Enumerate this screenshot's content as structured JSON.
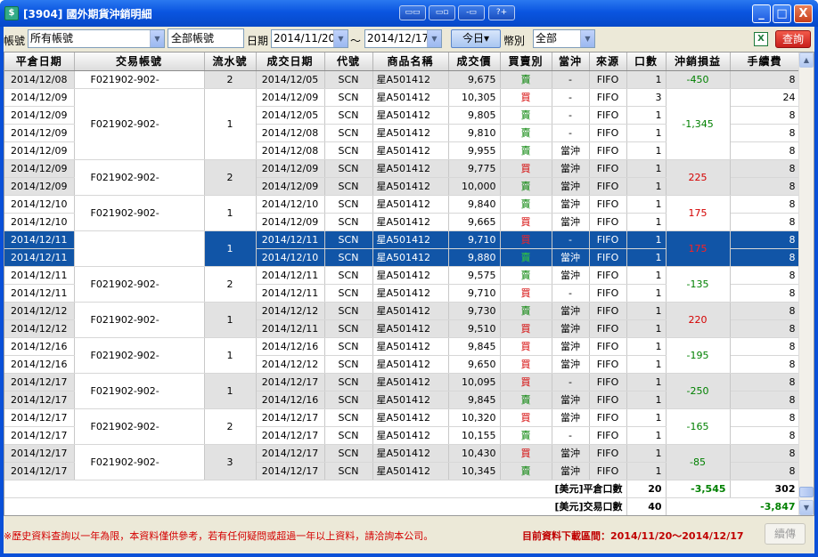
{
  "window": {
    "title": "[3904] 國外期貨沖銷明細",
    "app_icon": "app-icon",
    "toolbar_buttons": [
      "window-layout-icon-1",
      "window-layout-icon-2",
      "window-layout-icon-3",
      "window-layout-icon-4"
    ],
    "minimize": "_",
    "maximize": "□",
    "close": "X"
  },
  "filters": {
    "account_label": "帳號",
    "account_value": "所有帳號",
    "account_text": "全部帳號",
    "date_label": "日期",
    "date_from": "2014/11/20",
    "tilde": "～",
    "date_to": "2014/12/17",
    "today_button": "今日▾",
    "currency_label": "幣別",
    "currency_value": "全部",
    "query_button": "查詢"
  },
  "columns": [
    "平倉日期",
    "交易帳號",
    "流水號",
    "成交日期",
    "代號",
    "商品名稱",
    "成交價",
    "買賣別",
    "當沖",
    "來源",
    "口數",
    "沖銷損益",
    "手續費"
  ],
  "rows": [
    {
      "close_date": "2014/12/08",
      "trade_date": "2014/12/05",
      "code": "SCN",
      "product": "星A501412",
      "price": "9,675",
      "side": "賣",
      "daytrade": "-",
      "source": "FIFO",
      "lots": "1",
      "fee": "8"
    },
    {
      "close_date": "2014/12/09",
      "trade_date": "2014/12/09",
      "code": "SCN",
      "product": "星A501412",
      "price": "10,305",
      "side": "買",
      "daytrade": "-",
      "source": "FIFO",
      "lots": "3",
      "fee": "24"
    },
    {
      "close_date": "2014/12/09",
      "trade_date": "2014/12/05",
      "code": "SCN",
      "product": "星A501412",
      "price": "9,805",
      "side": "賣",
      "daytrade": "-",
      "source": "FIFO",
      "lots": "1",
      "fee": "8"
    },
    {
      "close_date": "2014/12/09",
      "trade_date": "2014/12/08",
      "code": "SCN",
      "product": "星A501412",
      "price": "9,810",
      "side": "賣",
      "daytrade": "-",
      "source": "FIFO",
      "lots": "1",
      "fee": "8"
    },
    {
      "close_date": "2014/12/09",
      "trade_date": "2014/12/08",
      "code": "SCN",
      "product": "星A501412",
      "price": "9,955",
      "side": "賣",
      "daytrade": "當沖",
      "source": "FIFO",
      "lots": "1",
      "fee": "8"
    },
    {
      "close_date": "2014/12/09",
      "trade_date": "2014/12/09",
      "code": "SCN",
      "product": "星A501412",
      "price": "9,775",
      "side": "買",
      "daytrade": "當沖",
      "source": "FIFO",
      "lots": "1",
      "fee": "8"
    },
    {
      "close_date": "2014/12/09",
      "trade_date": "2014/12/09",
      "code": "SCN",
      "product": "星A501412",
      "price": "10,000",
      "side": "賣",
      "daytrade": "當沖",
      "source": "FIFO",
      "lots": "1",
      "fee": "8"
    },
    {
      "close_date": "2014/12/10",
      "trade_date": "2014/12/10",
      "code": "SCN",
      "product": "星A501412",
      "price": "9,840",
      "side": "賣",
      "daytrade": "當沖",
      "source": "FIFO",
      "lots": "1",
      "fee": "8"
    },
    {
      "close_date": "2014/12/10",
      "trade_date": "2014/12/09",
      "code": "SCN",
      "product": "星A501412",
      "price": "9,665",
      "side": "買",
      "daytrade": "當沖",
      "source": "FIFO",
      "lots": "1",
      "fee": "8"
    },
    {
      "close_date": "2014/12/11",
      "trade_date": "2014/12/11",
      "code": "SCN",
      "product": "星A501412",
      "price": "9,710",
      "side": "買",
      "daytrade": "-",
      "source": "FIFO",
      "lots": "1",
      "fee": "8"
    },
    {
      "close_date": "2014/12/11",
      "trade_date": "2014/12/10",
      "code": "SCN",
      "product": "星A501412",
      "price": "9,880",
      "side": "賣",
      "daytrade": "當沖",
      "source": "FIFO",
      "lots": "1",
      "fee": "8"
    },
    {
      "close_date": "2014/12/11",
      "trade_date": "2014/12/11",
      "code": "SCN",
      "product": "星A501412",
      "price": "9,575",
      "side": "賣",
      "daytrade": "當沖",
      "source": "FIFO",
      "lots": "1",
      "fee": "8"
    },
    {
      "close_date": "2014/12/11",
      "trade_date": "2014/12/11",
      "code": "SCN",
      "product": "星A501412",
      "price": "9,710",
      "side": "買",
      "daytrade": "-",
      "source": "FIFO",
      "lots": "1",
      "fee": "8"
    },
    {
      "close_date": "2014/12/12",
      "trade_date": "2014/12/12",
      "code": "SCN",
      "product": "星A501412",
      "price": "9,730",
      "side": "賣",
      "daytrade": "當沖",
      "source": "FIFO",
      "lots": "1",
      "fee": "8"
    },
    {
      "close_date": "2014/12/12",
      "trade_date": "2014/12/11",
      "code": "SCN",
      "product": "星A501412",
      "price": "9,510",
      "side": "買",
      "daytrade": "當沖",
      "source": "FIFO",
      "lots": "1",
      "fee": "8"
    },
    {
      "close_date": "2014/12/16",
      "trade_date": "2014/12/16",
      "code": "SCN",
      "product": "星A501412",
      "price": "9,845",
      "side": "買",
      "daytrade": "當沖",
      "source": "FIFO",
      "lots": "1",
      "fee": "8"
    },
    {
      "close_date": "2014/12/16",
      "trade_date": "2014/12/12",
      "code": "SCN",
      "product": "星A501412",
      "price": "9,650",
      "side": "買",
      "daytrade": "當沖",
      "source": "FIFO",
      "lots": "1",
      "fee": "8"
    },
    {
      "close_date": "2014/12/17",
      "trade_date": "2014/12/17",
      "code": "SCN",
      "product": "星A501412",
      "price": "10,095",
      "side": "買",
      "daytrade": "-",
      "source": "FIFO",
      "lots": "1",
      "fee": "8"
    },
    {
      "close_date": "2014/12/17",
      "trade_date": "2014/12/16",
      "code": "SCN",
      "product": "星A501412",
      "price": "9,845",
      "side": "賣",
      "daytrade": "當沖",
      "source": "FIFO",
      "lots": "1",
      "fee": "8"
    },
    {
      "close_date": "2014/12/17",
      "trade_date": "2014/12/17",
      "code": "SCN",
      "product": "星A501412",
      "price": "10,320",
      "side": "買",
      "daytrade": "當沖",
      "source": "FIFO",
      "lots": "1",
      "fee": "8"
    },
    {
      "close_date": "2014/12/17",
      "trade_date": "2014/12/17",
      "code": "SCN",
      "product": "星A501412",
      "price": "10,155",
      "side": "賣",
      "daytrade": "-",
      "source": "FIFO",
      "lots": "1",
      "fee": "8"
    },
    {
      "close_date": "2014/12/17",
      "trade_date": "2014/12/17",
      "code": "SCN",
      "product": "星A501412",
      "price": "10,430",
      "side": "買",
      "daytrade": "當沖",
      "source": "FIFO",
      "lots": "1",
      "fee": "8"
    },
    {
      "close_date": "2014/12/17",
      "trade_date": "2014/12/17",
      "code": "SCN",
      "product": "星A501412",
      "price": "10,345",
      "side": "賣",
      "daytrade": "當沖",
      "source": "FIFO",
      "lots": "1",
      "fee": "8"
    }
  ],
  "groups": [
    {
      "start": 0,
      "span": 1,
      "account": "F021902-902-",
      "serial": "2",
      "pnl": "-450",
      "tone": "g"
    },
    {
      "start": 1,
      "span": 4,
      "account": "F021902-902-",
      "serial": "1",
      "pnl": "-1,345",
      "tone": "w"
    },
    {
      "start": 5,
      "span": 2,
      "account": "F021902-902-",
      "serial": "2",
      "pnl": "225",
      "tone": "g"
    },
    {
      "start": 7,
      "span": 2,
      "account": "F021902-902-",
      "serial": "1",
      "pnl": "175",
      "tone": "w"
    },
    {
      "start": 9,
      "span": 2,
      "account": "F021902-902-",
      "serial": "1",
      "pnl": "175",
      "tone": "sel"
    },
    {
      "start": 11,
      "span": 2,
      "account": "F021902-902-",
      "serial": "2",
      "pnl": "-135",
      "tone": "w"
    },
    {
      "start": 13,
      "span": 2,
      "account": "F021902-902-",
      "serial": "1",
      "pnl": "220",
      "tone": "g"
    },
    {
      "start": 15,
      "span": 2,
      "account": "F021902-902-",
      "serial": "1",
      "pnl": "-195",
      "tone": "w"
    },
    {
      "start": 17,
      "span": 2,
      "account": "F021902-902-",
      "serial": "1",
      "pnl": "-250",
      "tone": "g"
    },
    {
      "start": 19,
      "span": 2,
      "account": "F021902-902-",
      "serial": "2",
      "pnl": "-165",
      "tone": "w"
    },
    {
      "start": 21,
      "span": 2,
      "account": "F021902-902-",
      "serial": "3",
      "pnl": "-85",
      "tone": "g"
    }
  ],
  "summary": {
    "close_label": "[美元]平倉口數",
    "close_lots": "20",
    "close_pnl": "-3,545",
    "close_fee": "302",
    "trade_label": "[美元]交易口數",
    "trade_lots": "40",
    "trade_net": "-3,847"
  },
  "footer": {
    "note": "※歷史資料查詢以一年為限，本資料僅供參考，若有任何疑問或超過一年以上資料，請洽詢本公司。",
    "range": "目前資料下載區間：2014/11/20～2014/12/17",
    "continue_button": "續傳"
  },
  "colors": {
    "buy": "#d40000",
    "sell": "#008000",
    "selected_row": "#1155a7",
    "title_bar": "#0a55e0",
    "query_button": "#c8201c"
  }
}
